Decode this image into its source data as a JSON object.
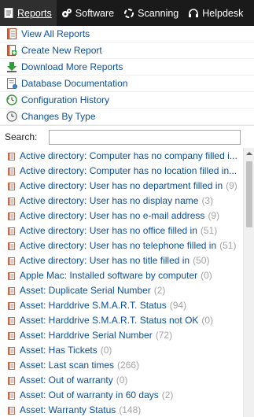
{
  "topbar": {
    "tabs": [
      {
        "label": "Reports",
        "icon": "reports-icon",
        "active": true
      },
      {
        "label": "Software",
        "icon": "software-icon",
        "active": false
      },
      {
        "label": "Scanning",
        "icon": "scanning-icon",
        "active": false
      },
      {
        "label": "Helpdesk",
        "icon": "helpdesk-icon",
        "active": false
      }
    ]
  },
  "menu": [
    {
      "label": "View All Reports",
      "icon": "report-document-icon"
    },
    {
      "label": "Create New Report",
      "icon": "create-report-icon"
    },
    {
      "label": "Download More Reports",
      "icon": "download-icon"
    },
    {
      "label": "Database Documentation",
      "icon": "database-doc-icon"
    },
    {
      "label": "Configuration History",
      "icon": "history-icon"
    },
    {
      "label": "Changes By Type",
      "icon": "clock-icon"
    }
  ],
  "search": {
    "label": "Search:",
    "value": ""
  },
  "reports": [
    {
      "title": "Active directory: Computer has no company filled i...",
      "count": ""
    },
    {
      "title": "Active directory: Computer has no location filled in...",
      "count": ""
    },
    {
      "title": "Active directory: User has no department filled in",
      "count": "(9)"
    },
    {
      "title": "Active directory: User has no display name",
      "count": "(3)"
    },
    {
      "title": "Active directory: User has no e-mail address",
      "count": "(9)"
    },
    {
      "title": "Active directory: User has no office filled in",
      "count": "(51)"
    },
    {
      "title": "Active directory: User has no telephone filled in",
      "count": "(51)"
    },
    {
      "title": "Active directory: User has no title filled in",
      "count": "(50)"
    },
    {
      "title": "Apple Mac: Installed software by computer",
      "count": "(0)"
    },
    {
      "title": "Asset: Duplicate Serial Number",
      "count": "(2)"
    },
    {
      "title": "Asset: Harddrive S.M.A.R.T. Status",
      "count": "(94)"
    },
    {
      "title": "Asset: Harddrive S.M.A.R.T. Status not OK",
      "count": "(0)"
    },
    {
      "title": "Asset: Harddrive Serial Number",
      "count": "(72)"
    },
    {
      "title": "Asset: Has Tickets",
      "count": "(0)"
    },
    {
      "title": "Asset: Last scan times",
      "count": "(266)"
    },
    {
      "title": "Asset: Out of warranty",
      "count": "(0)"
    },
    {
      "title": "Asset: Out of warranty in 60 days",
      "count": "(2)"
    },
    {
      "title": "Asset: Warranty Status",
      "count": "(148)"
    }
  ],
  "colors": {
    "topbar": "#1a1a1a",
    "link": "#0b4f9e",
    "count": "#a3a3a3"
  }
}
